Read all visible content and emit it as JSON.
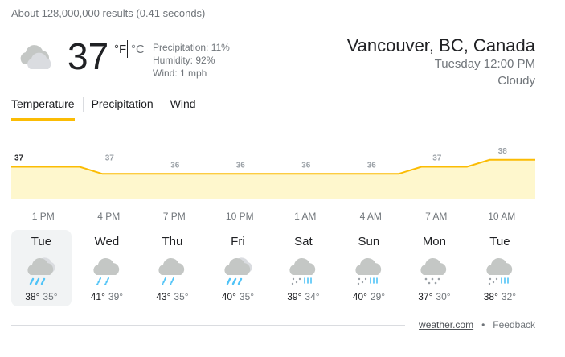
{
  "result_stats": "About 128,000,000 results (0.41 seconds)",
  "current": {
    "temperature": "37",
    "unit_f": "°F",
    "unit_c": "°C",
    "precipitation": "Precipitation: 11%",
    "humidity": "Humidity: 92%",
    "wind": "Wind: 1 mph",
    "icon": "cloudy-icon"
  },
  "location": {
    "name": "Vancouver, BC, Canada",
    "time": "Tuesday 12:00 PM",
    "condition": "Cloudy"
  },
  "tabs": [
    {
      "label": "Temperature",
      "active": true
    },
    {
      "label": "Precipitation",
      "active": false
    },
    {
      "label": "Wind",
      "active": false
    }
  ],
  "chart_data": {
    "type": "area",
    "point_labels": [
      "37",
      "37",
      "36",
      "36",
      "36",
      "36",
      "37",
      "38"
    ],
    "x": [
      "1 PM",
      "4 PM",
      "7 PM",
      "10 PM",
      "1 AM",
      "4 AM",
      "7 AM",
      "10 AM"
    ],
    "hourly_values": [
      37,
      37,
      37,
      37,
      36,
      36,
      36,
      36,
      36,
      36,
      36,
      36,
      36,
      36,
      36,
      36,
      36,
      36,
      37,
      37,
      37,
      38,
      38,
      38
    ],
    "fill_color": "#fef7cd",
    "line_color": "#fbbc04"
  },
  "days": [
    {
      "name": "Tue",
      "hi": "38°",
      "lo": "35°",
      "icon": "rain-icon",
      "selected": true
    },
    {
      "name": "Wed",
      "hi": "41°",
      "lo": "39°",
      "icon": "showers-icon",
      "selected": false
    },
    {
      "name": "Thu",
      "hi": "43°",
      "lo": "35°",
      "icon": "showers-icon",
      "selected": false
    },
    {
      "name": "Fri",
      "hi": "40°",
      "lo": "35°",
      "icon": "rain-icon",
      "selected": false
    },
    {
      "name": "Sat",
      "hi": "39°",
      "lo": "34°",
      "icon": "rain-snow-icon",
      "selected": false
    },
    {
      "name": "Sun",
      "hi": "40°",
      "lo": "29°",
      "icon": "rain-snow-icon",
      "selected": false
    },
    {
      "name": "Mon",
      "hi": "37°",
      "lo": "30°",
      "icon": "snow-icon",
      "selected": false
    },
    {
      "name": "Tue",
      "hi": "38°",
      "lo": "32°",
      "icon": "rain-snow-icon",
      "selected": false
    }
  ],
  "footer": {
    "source": "weather.com",
    "separator": "•",
    "feedback": "Feedback"
  }
}
